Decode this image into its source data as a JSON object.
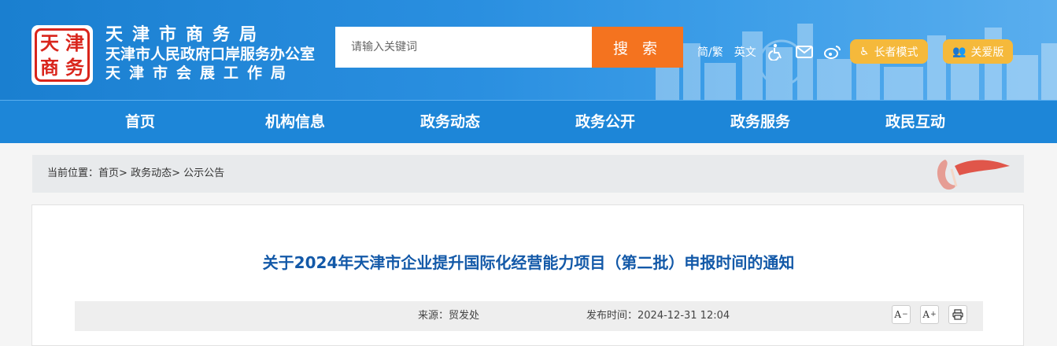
{
  "header": {
    "logo_chars": [
      "天",
      "津",
      "商",
      "务"
    ],
    "org_names": [
      "天津市商务局",
      "天津市人民政府口岸服务办公室",
      "天津市会展工作局"
    ]
  },
  "search": {
    "placeholder": "请输入关键词",
    "button_label": "搜 索"
  },
  "tools": {
    "lang_simplified_traditional": "简/繁",
    "lang_english": "英文",
    "elder_mode": "长者模式",
    "care_version": "关爱版",
    "icons": [
      "accessibility-icon",
      "mail-icon",
      "weibo-icon"
    ]
  },
  "nav": {
    "items": [
      "首页",
      "机构信息",
      "政务动态",
      "政务公开",
      "政务服务",
      "政民互动"
    ]
  },
  "breadcrumb": {
    "prefix": "当前位置：",
    "items": [
      "首页",
      "政务动态",
      "公示公告"
    ],
    "separator": ">"
  },
  "article": {
    "title": "关于2024年天津市企业提升国际化经营能力项目（第二批）申报时间的通知",
    "source": "来源：贸发处",
    "publish_time": "发布时间：2024-12-31 12:04",
    "font_decrease": "A",
    "font_increase": "A"
  },
  "colors": {
    "header_blue": "#1a7fd0",
    "nav_blue": "#1d86d8",
    "search_orange": "#f4731f",
    "mode_yellow": "#f5b93b",
    "title_blue": "#1359a8"
  }
}
